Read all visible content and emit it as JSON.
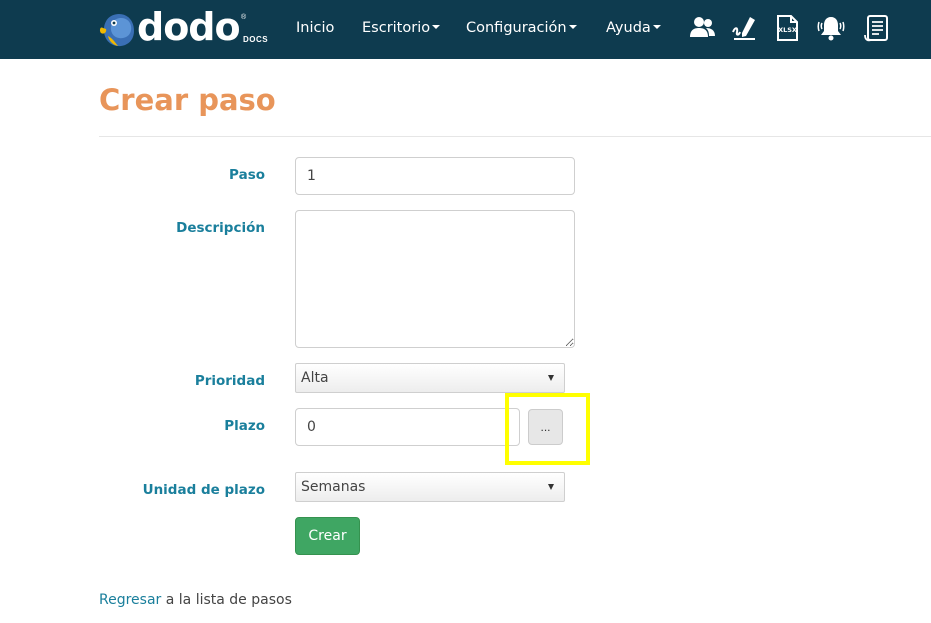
{
  "brand": {
    "name": "dodo",
    "sub": "DOCS",
    "reg": "®"
  },
  "nav": {
    "items": [
      {
        "label": "Inicio",
        "dropdown": false
      },
      {
        "label": "Escritorio",
        "dropdown": true
      },
      {
        "label": "Configuración",
        "dropdown": true
      },
      {
        "label": "Ayuda",
        "dropdown": true
      }
    ],
    "icons": [
      "users-icon",
      "signature-icon",
      "xlsx-file-icon",
      "alarm-bell-icon",
      "document-list-icon"
    ],
    "xlsx_text": "XLSX"
  },
  "page": {
    "title": "Crear paso"
  },
  "form": {
    "paso": {
      "label": "Paso",
      "value": "1"
    },
    "descripcion": {
      "label": "Descripción",
      "value": ""
    },
    "prioridad": {
      "label": "Prioridad",
      "selected": "Alta"
    },
    "plazo": {
      "label": "Plazo",
      "value": "0",
      "button_label": "..."
    },
    "unidad": {
      "label": "Unidad de plazo",
      "selected": "Semanas"
    },
    "submit_label": "Crear"
  },
  "footer": {
    "link_text": "Regresar",
    "rest_text": " a la lista de pasos"
  },
  "colors": {
    "navbar": "#0e3b4f",
    "title": "#e8955a",
    "label": "#1a7f9c",
    "submit": "#3fa663",
    "highlight": "#ffff00"
  }
}
